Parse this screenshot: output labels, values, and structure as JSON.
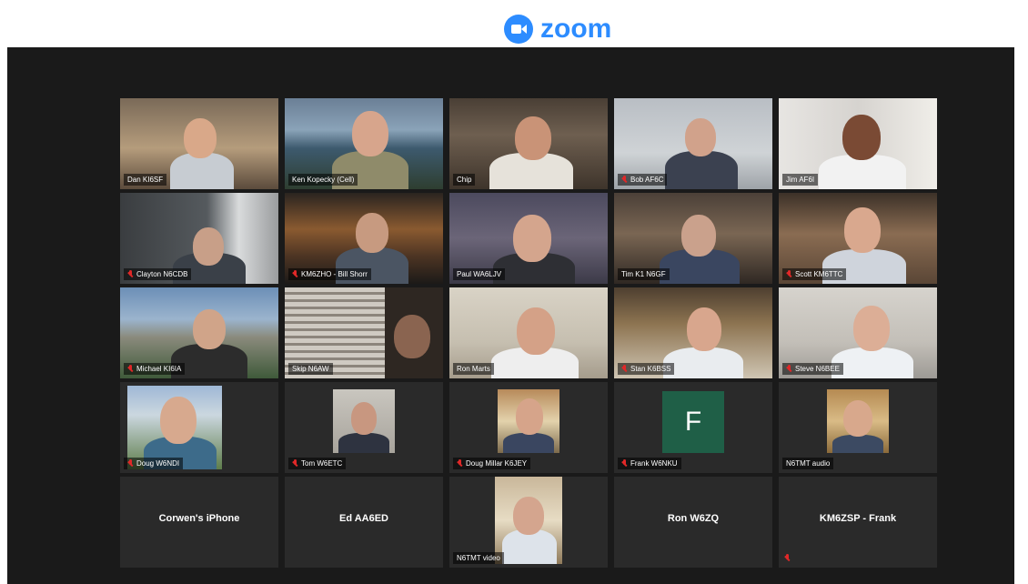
{
  "app": {
    "logo_text": "zoom",
    "brand_color": "#2D8CFF",
    "active_speaker_color": "#d9df3c"
  },
  "participants": {
    "r1": [
      {
        "name": "Dan KI6SF",
        "muted": false,
        "active": true
      },
      {
        "name": "Ken Kopecky (Cell)",
        "muted": false
      },
      {
        "name": "Chip",
        "muted": false
      },
      {
        "name": "Bob AF6C",
        "muted": true
      },
      {
        "name": "Jim AF6I",
        "muted": false
      }
    ],
    "r2": [
      {
        "name": "Clayton N6CDB",
        "muted": true
      },
      {
        "name": "KM6ZHO - Bill Shorr",
        "muted": true
      },
      {
        "name": "Paul WA6LJV",
        "muted": false
      },
      {
        "name": "Tim K1 N6GF",
        "muted": false
      },
      {
        "name": "Scott KM6TTC",
        "muted": true
      }
    ],
    "r3": [
      {
        "name": "Michael KI6IA",
        "muted": true
      },
      {
        "name": "Skip N6AW",
        "muted": false
      },
      {
        "name": "Ron Marts",
        "muted": false
      },
      {
        "name": "Stan K6BSS",
        "muted": true
      },
      {
        "name": "Steve N6BEE",
        "muted": true
      }
    ],
    "r4": [
      {
        "name": "Doug W6NDI",
        "muted": true
      },
      {
        "name": "Tom W6ETC",
        "muted": true
      },
      {
        "name": "Doug Millar K6JEY",
        "muted": true
      },
      {
        "name": "Frank W6NKU",
        "muted": true,
        "initial": "F"
      },
      {
        "name": "N6TMT audio",
        "muted": false
      }
    ],
    "r5": [
      {
        "name": "Corwen's iPhone"
      },
      {
        "name": "Ed AA6ED"
      },
      {
        "name": "N6TMT video"
      },
      {
        "name": "Ron W6ZQ"
      },
      {
        "name": "KM6ZSP - Frank",
        "muted": true
      }
    ]
  }
}
